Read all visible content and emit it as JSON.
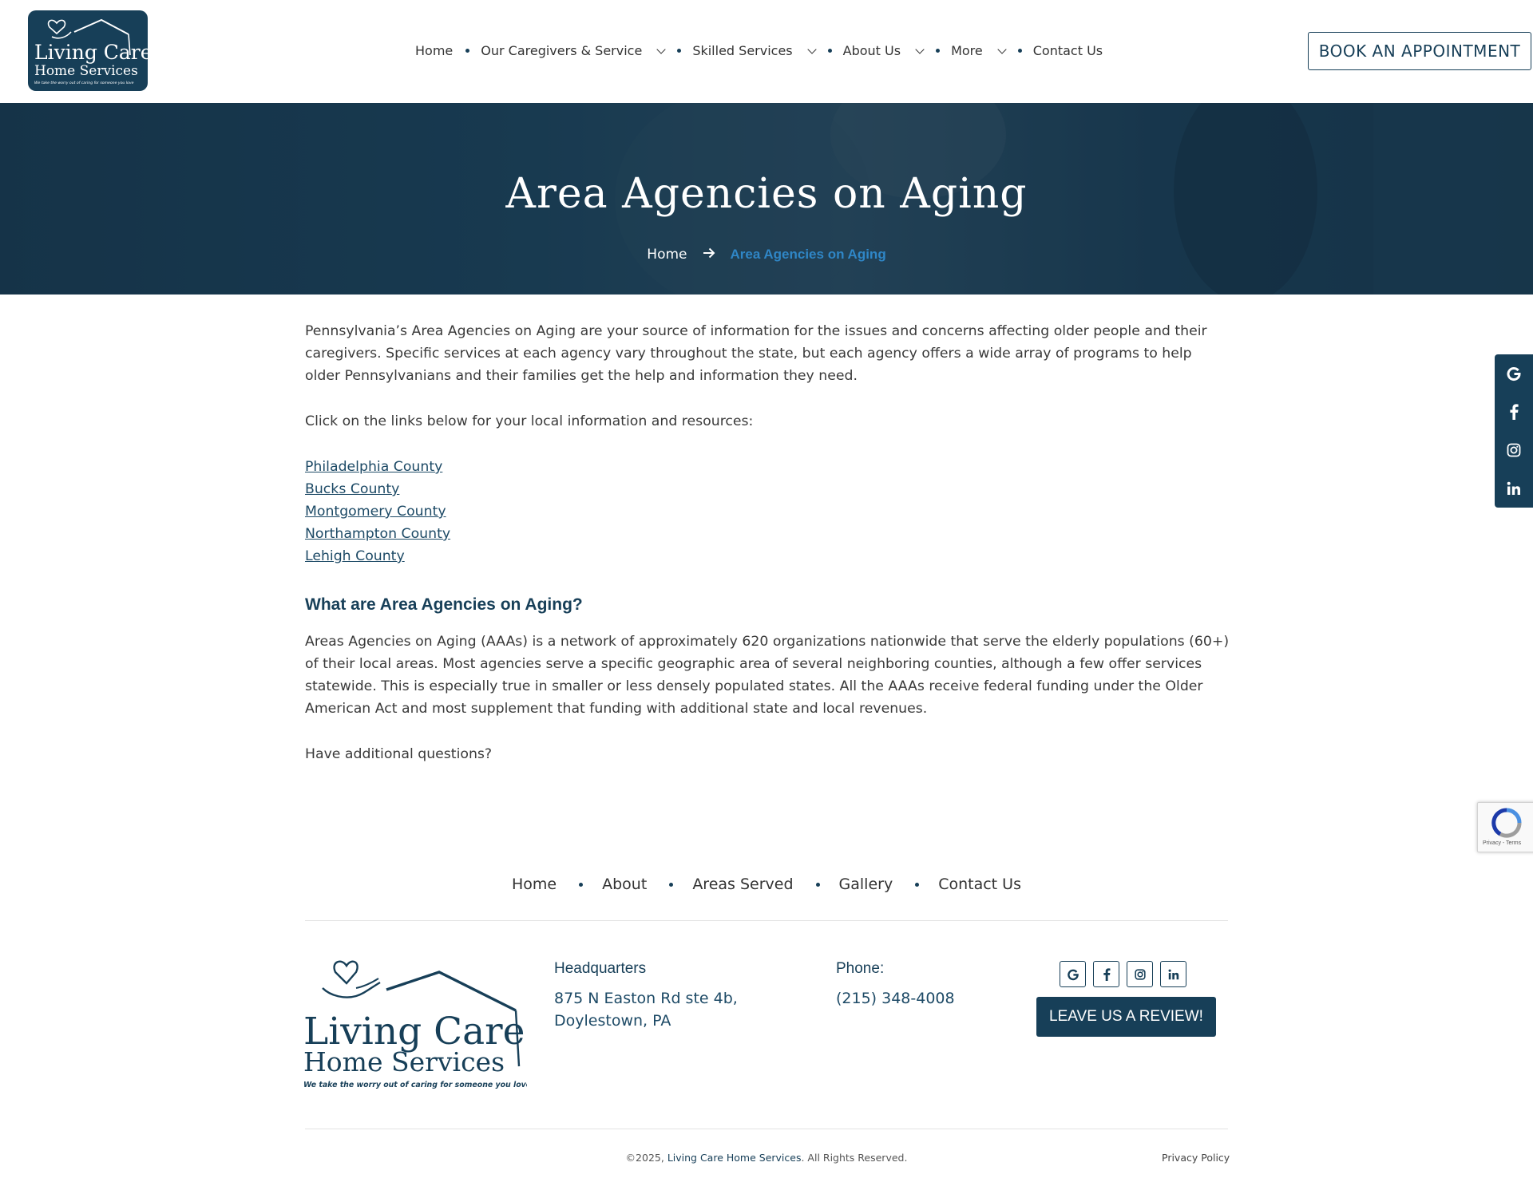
{
  "header": {
    "logo": {
      "line1": "Living Care",
      "line2": "Home Services",
      "tagline": "We take the worry out of caring for someone you love"
    },
    "nav": [
      {
        "label": "Home",
        "dropdown": false
      },
      {
        "label": "Our Caregivers & Service",
        "dropdown": true
      },
      {
        "label": "Skilled Services",
        "dropdown": true
      },
      {
        "label": "About Us",
        "dropdown": true
      },
      {
        "label": "More",
        "dropdown": true
      },
      {
        "label": "Contact Us",
        "dropdown": false
      }
    ],
    "cta_label": "BOOK AN APPOINTMENT"
  },
  "hero": {
    "title": "Area Agencies on Aging",
    "breadcrumb": {
      "home": "Home",
      "current": "Area Agencies on Aging"
    }
  },
  "content": {
    "intro": "Pennsylvania’s Area Agencies on Aging are your source of information for the issues and concerns affecting older people and their caregivers. Specific services at each agency vary throughout the state, but each agency offers a wide array of programs to help older Pennsylvanians and their families get the help and information they need.",
    "links_intro": "Click on the links below for your local information and resources:",
    "county_links": [
      "Philadelphia County",
      "Bucks County",
      "Montgomery County",
      "Northampton County",
      "Lehigh County"
    ],
    "heading": "What are Area Agencies on Aging?",
    "body": "Areas Agencies on Aging (AAAs) is a network of approximately 620 organizations nationwide that serve the elderly populations (60+) of their local areas. Most agencies serve a specific geographic area of several neighboring counties, although a few offer services statewide. This is especially true in smaller or less densely populated states. All the AAAs receive federal funding under the Older American Act and most supplement that funding with additional state and local revenues.",
    "closing": "Have additional questions?"
  },
  "social_sidebar": [
    "google-icon",
    "facebook-icon",
    "instagram-icon",
    "linkedin-icon"
  ],
  "recaptcha": {
    "text": "Privacy - Terms"
  },
  "footer": {
    "nav": [
      "Home",
      "About",
      "Areas Served",
      "Gallery",
      "Contact Us"
    ],
    "hq_title": "Headquarters",
    "hq_address_line1": "875 N Easton Rd ste 4b,",
    "hq_address_line2": "Doylestown, PA",
    "phone_title": "Phone:",
    "phone": "(215) 348-4008",
    "review_label": "LEAVE US A REVIEW!",
    "copyright_prefix": "©2025, ",
    "copyright_brand": "Living Care Home Services",
    "copyright_suffix": ". All Rights Reserved.",
    "privacy": "Privacy Policy"
  },
  "colors": {
    "brand_navy": "#173f58",
    "link_blue": "#1d4a66",
    "breadcrumb_active": "#2f86c6"
  }
}
